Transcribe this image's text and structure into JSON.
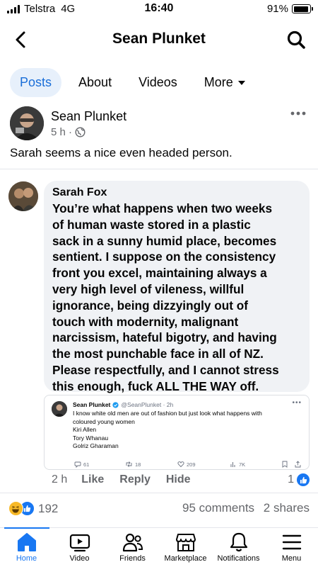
{
  "status": {
    "carrier": "Telstra",
    "network": "4G",
    "time": "16:40",
    "battery": "91%",
    "battery_level": 0.91
  },
  "header": {
    "title": "Sean Plunket"
  },
  "tabs": [
    {
      "label": "Posts",
      "active": true
    },
    {
      "label": "About"
    },
    {
      "label": "Videos"
    },
    {
      "label": "More"
    }
  ],
  "post": {
    "author": "Sean Plunket",
    "time": "5 h ·",
    "text": "Sarah seems a nice even headed person."
  },
  "comment": {
    "author": "Sarah Fox",
    "lines": [
      "You’re what happens when two weeks",
      "of human waste stored in a plastic",
      "sack in a sunny humid place, becomes",
      "sentient. I suppose on the consistency",
      "front you excel, maintaining always a",
      "very high level of vileness, willful",
      "ignorance, being dizzyingly out of",
      "touch with modernity, malignant",
      "narcissism, hateful bigotry, and having",
      "the most punchable face in all of NZ.",
      "Please respectfully, and I cannot stress",
      "this enough, fuck ALL THE WAY off."
    ],
    "time": "2 h",
    "like_label": "Like",
    "reply_label": "Reply",
    "hide_label": "Hide",
    "likes": "1"
  },
  "tweet": {
    "name": "Sean Plunket",
    "handle": "@SeanPlunket · 2h",
    "lines": [
      "I know white old men are out of fashion but just look what happens with",
      "coloured young women",
      "Kiri Allen",
      "Tory Whanau",
      "Golriz Gharaman"
    ],
    "replies": "61",
    "retweets": "18",
    "likes": "209",
    "views": "7K"
  },
  "summary": {
    "reactions": "192",
    "comments": "95 comments",
    "shares": "2 shares"
  },
  "nav": [
    {
      "label": "Home",
      "icon": "home-icon",
      "active": true
    },
    {
      "label": "Video",
      "icon": "video-icon"
    },
    {
      "label": "Friends",
      "icon": "friends-icon"
    },
    {
      "label": "Marketplace",
      "icon": "marketplace-icon"
    },
    {
      "label": "Notifications",
      "icon": "bell-icon"
    },
    {
      "label": "Menu",
      "icon": "menu-icon"
    }
  ],
  "colors": {
    "accent": "#1877f2",
    "tab_active_bg": "#e7f0fb",
    "bubble": "#f0f2f5",
    "muted": "#65676b"
  }
}
